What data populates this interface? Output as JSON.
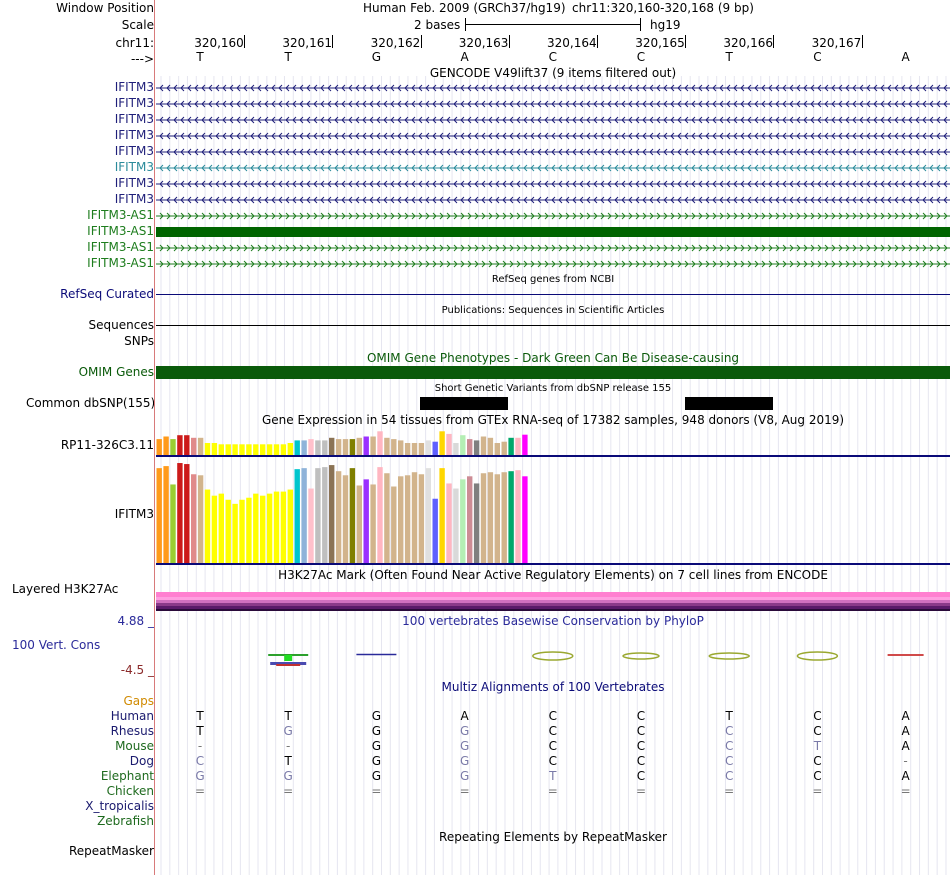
{
  "colors": {
    "gencode": "#1f1f7a",
    "gencode_highlight": "#2b8b9b",
    "antisense": "#1e7d1e",
    "antisense_dark": "#006400",
    "omim": "#0a5a0a",
    "refseq": "#0a0a78",
    "phylop_pos": "#2a2a9a",
    "phylop_neg": "#8b2a2a",
    "gaps": "#d08a00",
    "conserved_green": "#2d6e2d",
    "red_divider": "#d87a7a"
  },
  "labels": {
    "window_position": "Window Position",
    "scale": "Scale",
    "chrom": "chr11:",
    "strand": "--->",
    "refseq_curated": "RefSeq Curated",
    "sequences": "Sequences",
    "snps": "SNPs",
    "omim_genes": "OMIM Genes",
    "common_dbsnp": "Common dbSNP(155)",
    "rp11": "RP11-326C3.11",
    "ifitm3_gtex": "IFITM3",
    "layered_h3k27ac": "Layered H3K27Ac",
    "phylop_max": "4.88 _",
    "vert_cons": "100 Vert. Cons",
    "phylop_min": "-4.5 _",
    "gaps": "Gaps",
    "repeatmasker": "RepeatMasker"
  },
  "header": {
    "assembly": "Human Feb. 2009 (GRCh37/hg19)",
    "position": "chr11:320,160-320,168 (9 bp)",
    "scale_text": "2 bases",
    "scale_db": "hg19"
  },
  "ruler": {
    "ticks": [
      "320,160",
      "320,161",
      "320,162",
      "320,163",
      "320,164",
      "320,165",
      "320,166",
      "320,167"
    ]
  },
  "sequence": [
    "T",
    "T",
    "G",
    "A",
    "C",
    "C",
    "T",
    "C",
    "A"
  ],
  "gencode": {
    "title": "GENCODE V49lift37 (9 items filtered out)",
    "genes": [
      {
        "name": "IFITM3",
        "dir": "left",
        "style": "normal"
      },
      {
        "name": "IFITM3",
        "dir": "left",
        "style": "normal"
      },
      {
        "name": "IFITM3",
        "dir": "left",
        "style": "normal"
      },
      {
        "name": "IFITM3",
        "dir": "left",
        "style": "normal"
      },
      {
        "name": "IFITM3",
        "dir": "left",
        "style": "normal"
      },
      {
        "name": "IFITM3",
        "dir": "left",
        "style": "highlight"
      },
      {
        "name": "IFITM3",
        "dir": "left",
        "style": "normal"
      },
      {
        "name": "IFITM3",
        "dir": "left",
        "style": "normal"
      },
      {
        "name": "IFITM3-AS1",
        "dir": "right",
        "style": "antisense"
      },
      {
        "name": "IFITM3-AS1",
        "dir": "right",
        "style": "antisense_block"
      },
      {
        "name": "IFITM3-AS1",
        "dir": "right",
        "style": "antisense"
      },
      {
        "name": "IFITM3-AS1",
        "dir": "right",
        "style": "antisense"
      }
    ]
  },
  "refseq_title": "RefSeq genes from NCBI",
  "publications_title": "Publications: Sequences in Scientific Articles",
  "omim_title": "OMIM Gene Phenotypes - Dark Green Can Be Disease-causing",
  "dbsnp_title": "Short Genetic Variants from dbSNP release 155",
  "gtex": {
    "title": "Gene Expression in 54 tissues from GTEx RNA-seq of 17382 samples, 948 donors (V8, Aug 2019)",
    "tissue_colors": [
      "#ff9a1a",
      "#ff9a1a",
      "#9acd32",
      "#cc1a1a",
      "#cc1a1a",
      "#e08a8a",
      "#d2b48c",
      "#ffff00",
      "#ffff00",
      "#ffff00",
      "#ffff00",
      "#ffff00",
      "#ffff00",
      "#ffff00",
      "#ffff00",
      "#ffff00",
      "#ffff00",
      "#ffff00",
      "#ffff00",
      "#ffff00",
      "#00c5cd",
      "#8fb3d9",
      "#ffc0cb",
      "#bfbfbf",
      "#bfbfbf",
      "#8b7355",
      "#d2b48c",
      "#d2b48c",
      "#7f7f00",
      "#d2b48c",
      "#9b30ff",
      "#d2b48c",
      "#ffb6c1",
      "#d2b48c",
      "#d2b48c",
      "#d2b48c",
      "#d2b48c",
      "#d2b48c",
      "#d2b48c",
      "#e0e0e0",
      "#5f5fff",
      "#ffd700",
      "#ffb6c1",
      "#d9d9d9",
      "#b4eeb4",
      "#cd8c95",
      "#7f7f7f",
      "#d2b48c",
      "#d2b48c",
      "#d2b48c",
      "#d2b48c",
      "#00a86b",
      "#ffb6c1",
      "#ff00ff"
    ],
    "rp11_values": [
      0.65,
      0.75,
      0.65,
      0.8,
      0.8,
      0.7,
      0.7,
      0.5,
      0.5,
      0.45,
      0.45,
      0.45,
      0.45,
      0.45,
      0.45,
      0.45,
      0.45,
      0.45,
      0.45,
      0.5,
      0.6,
      0.6,
      0.65,
      0.6,
      0.6,
      0.7,
      0.65,
      0.65,
      0.65,
      0.7,
      0.75,
      0.75,
      0.95,
      0.7,
      0.65,
      0.6,
      0.5,
      0.5,
      0.5,
      0.6,
      0.55,
      0.95,
      0.85,
      0.5,
      0.8,
      0.65,
      0.6,
      0.75,
      0.7,
      0.5,
      0.55,
      0.7,
      0.7,
      0.82
    ],
    "ifitm3_values": [
      0.93,
      0.95,
      0.77,
      0.98,
      0.97,
      0.87,
      0.86,
      0.72,
      0.66,
      0.68,
      0.62,
      0.58,
      0.62,
      0.64,
      0.68,
      0.66,
      0.68,
      0.7,
      0.7,
      0.72,
      0.92,
      0.93,
      0.73,
      0.93,
      0.94,
      0.96,
      0.9,
      0.86,
      0.93,
      0.76,
      0.82,
      0.77,
      0.94,
      0.88,
      0.75,
      0.85,
      0.86,
      0.89,
      0.87,
      0.93,
      0.63,
      0.93,
      0.78,
      0.73,
      0.82,
      0.85,
      0.78,
      0.88,
      0.89,
      0.87,
      0.89,
      0.9,
      0.91,
      0.85
    ]
  },
  "h3k27ac_title": "H3K27Ac Mark (Often Found Near Active Regulatory Elements) on 7 cell lines from ENCODE",
  "h3k27ac_colors": [
    "#ff7fd0",
    "#ff9ee0",
    "#d070c0",
    "#8a3a8a",
    "#5a1a6a",
    "#2a0a3a"
  ],
  "phylop_title": "100 vertebrates Basewise Conservation by PhyloP",
  "multiz_title": "Multiz Alignments of 100 Vertebrates",
  "species": [
    {
      "name": "Human",
      "color": "#1a1a6e",
      "bases": [
        "T",
        "T",
        "G",
        "A",
        "C",
        "C",
        "T",
        "C",
        "A"
      ]
    },
    {
      "name": "Rhesus",
      "color": "#1a1a6e",
      "bases": [
        "T",
        "G",
        "G",
        "G",
        "C",
        "C",
        "C",
        "C",
        "A"
      ]
    },
    {
      "name": "Mouse",
      "color": "#1e6a1e",
      "bases": [
        "-",
        "-",
        "G",
        "G",
        "C",
        "C",
        "C",
        "T",
        "A"
      ]
    },
    {
      "name": "Dog",
      "color": "#1a1a6e",
      "bases": [
        "C",
        "T",
        "G",
        "G",
        "C",
        "C",
        "C",
        "C",
        "-"
      ]
    },
    {
      "name": "Elephant",
      "color": "#1e6a1e",
      "bases": [
        "G",
        "G",
        "G",
        "G",
        "T",
        "C",
        "C",
        "C",
        "A"
      ]
    },
    {
      "name": "Chicken",
      "color": "#1e6a1e",
      "bases": [
        "=",
        "=",
        "=",
        "=",
        "=",
        "=",
        "=",
        "=",
        "="
      ]
    },
    {
      "name": "X_tropicalis",
      "color": "#1a1a6e",
      "bases": [
        "",
        "",
        "",
        "",
        "",
        "",
        "",
        "",
        ""
      ]
    },
    {
      "name": "Zebrafish",
      "color": "#1e6a1e",
      "bases": [
        "",
        "",
        "",
        "",
        "",
        "",
        "",
        "",
        ""
      ]
    }
  ],
  "repeatmasker_title": "Repeating Elements by RepeatMasker"
}
